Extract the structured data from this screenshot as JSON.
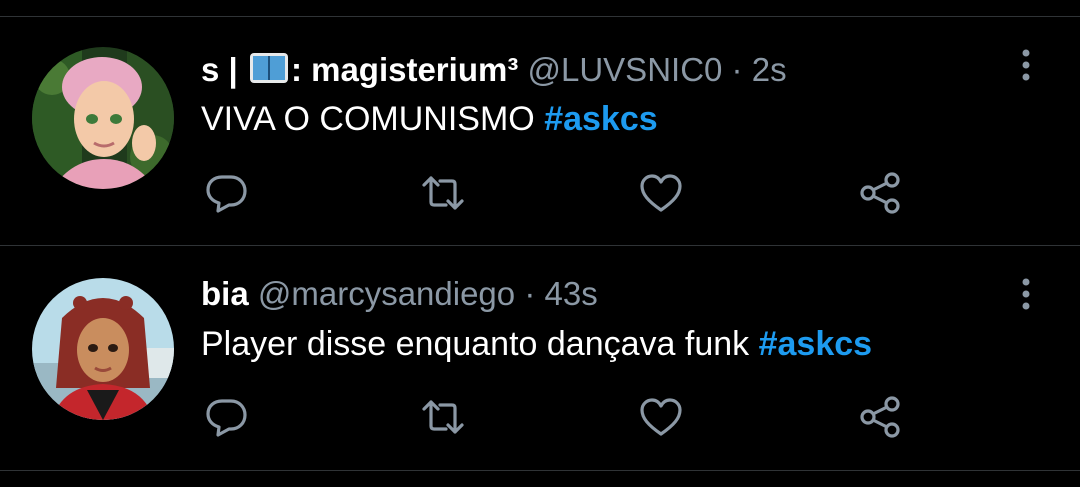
{
  "colors": {
    "background": "#000000",
    "divider": "#2f3336",
    "secondary_text": "#8b98a5",
    "hashtag": "#1d9bf0"
  },
  "tweets": [
    {
      "name_prefix": "s |",
      "name_icon": "open-book-emoji",
      "name_suffix": ": magisterium³",
      "handle": "@LUVSNIC0",
      "separator": "·",
      "time": "2s",
      "text": "VIVA O COMUNISMO",
      "hashtag": "#askcs"
    },
    {
      "name_prefix": "bia",
      "handle": "@marcysandiego",
      "separator": "·",
      "time": "43s",
      "text": "Player disse enquanto dançava funk",
      "hashtag": "#askcs"
    }
  ],
  "icons": {
    "reply": "reply-icon",
    "retweet": "retweet-icon",
    "like": "heart-icon",
    "share": "share-icon",
    "more": "more-vertical-icon"
  }
}
